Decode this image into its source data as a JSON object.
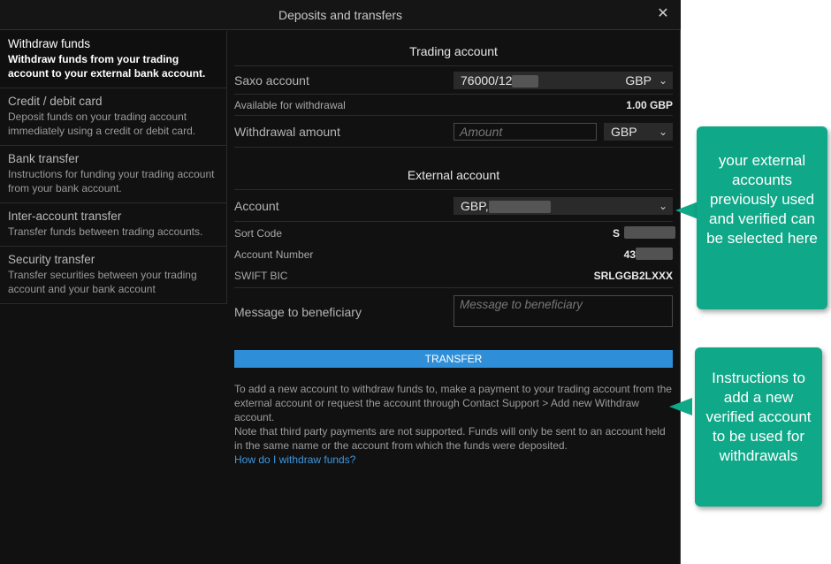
{
  "dialog": {
    "title": "Deposits and transfers",
    "close_glyph": "✕"
  },
  "sidebar": {
    "items": [
      {
        "title": "Withdraw funds",
        "desc": "Withdraw funds from your trading account to your external bank account."
      },
      {
        "title": "Credit / debit card",
        "desc": "Deposit funds on your trading account immediately using a credit or debit card."
      },
      {
        "title": "Bank transfer",
        "desc": "Instructions for funding your trading account from your bank account."
      },
      {
        "title": "Inter-account transfer",
        "desc": "Transfer funds between trading accounts."
      },
      {
        "title": "Security transfer",
        "desc": "Transfer securities between your trading account and your bank account"
      }
    ]
  },
  "trading": {
    "heading": "Trading account",
    "saxo_label": "Saxo account",
    "saxo_value": "76000/12",
    "saxo_currency": "GBP",
    "available_label": "Available for withdrawal",
    "available_value": "1.00 GBP",
    "amount_label": "Withdrawal amount",
    "amount_placeholder": "Amount",
    "amount_currency": "GBP"
  },
  "external": {
    "heading": "External account",
    "account_label": "Account",
    "account_value": "GBP,",
    "sort_label": "Sort Code",
    "sort_value": "S",
    "number_label": "Account Number",
    "number_value": "43",
    "swift_label": "SWIFT BIC",
    "swift_value": "SRLGGB2LXXX",
    "message_label": "Message to beneficiary",
    "message_placeholder": "Message to beneficiary"
  },
  "transfer_label": "TRANSFER",
  "info": {
    "line1": "To add a new account to withdraw funds to, make a payment to your trading account from the external account or request the account through Contact Support > Add new Withdraw account.",
    "line2": "Note that third party payments are not supported. Funds will only be sent to an account held in the same name or the account from which the funds were deposited.",
    "link": "How do I withdraw funds?"
  },
  "callouts": {
    "one": "your external accounts previously used and verified can be selected here",
    "two": "Instructions to add a new verified account to be used for withdrawals"
  },
  "icons": {
    "chevron": "chevron-down-icon",
    "close": "close-icon"
  },
  "colors": {
    "accent": "#2e8fd8",
    "callout": "#0fa888",
    "background": "#111111"
  }
}
